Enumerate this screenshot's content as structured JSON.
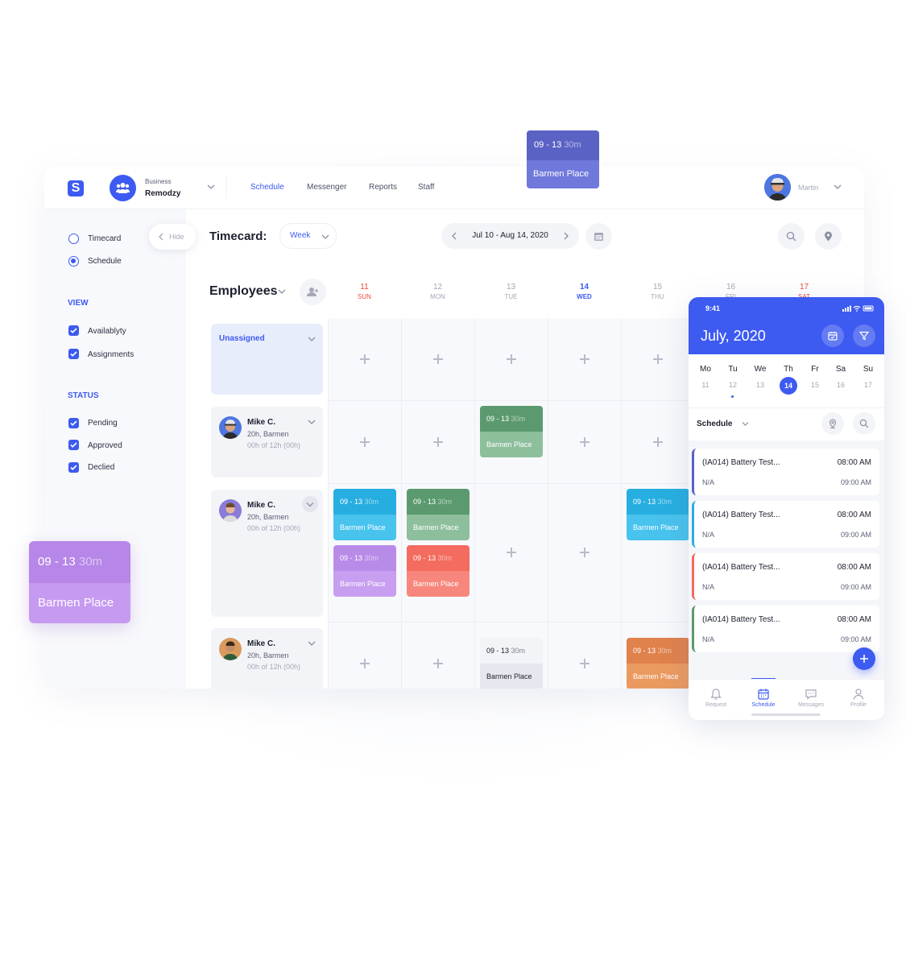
{
  "header": {
    "business_small": "Business",
    "business_name": "Remodzy",
    "nav": [
      "Schedule",
      "Messenger",
      "Reports",
      "Staff"
    ],
    "user_name": "Martin"
  },
  "sidebar": {
    "mode_options": [
      {
        "label": "Timecard",
        "selected": false
      },
      {
        "label": "Schedule",
        "selected": true
      }
    ],
    "view_heading": "VIEW",
    "view_items": [
      "Availablyty",
      "Assignments"
    ],
    "status_heading": "STATUS",
    "status_items": [
      "Pending",
      "Approved",
      "Declied"
    ],
    "hide_label": "Hide"
  },
  "toolbar": {
    "title": "Timecard:",
    "period": "Week",
    "date_range": "Jul 10 - Aug 14, 2020"
  },
  "grid": {
    "employees_title": "Employees",
    "days": [
      {
        "num": "11",
        "name": "SUN",
        "state": "weekend"
      },
      {
        "num": "12",
        "name": "MON",
        "state": "normal"
      },
      {
        "num": "13",
        "name": "TUE",
        "state": "normal"
      },
      {
        "num": "14",
        "name": "WED",
        "state": "today"
      },
      {
        "num": "15",
        "name": "THU",
        "state": "normal"
      },
      {
        "num": "16",
        "name": "FRI",
        "state": "normal"
      },
      {
        "num": "17",
        "name": "SAT",
        "state": "weekend"
      }
    ],
    "unassigned_label": "Unassigned",
    "employees": [
      {
        "name": "Mike C.",
        "role": "20h, Barmen",
        "hours": "00h of 12h (00h)"
      },
      {
        "name": "Mike C.",
        "role": "20h, Barmen",
        "hours": "00h of 12h (00h)"
      },
      {
        "name": "Mike C.",
        "role": "20h, Barmen",
        "hours": "00h of 12h (00h)"
      }
    ],
    "shift_time": "09 - 13",
    "shift_duration": "30m",
    "shift_place": "Barmen Place"
  },
  "colors": {
    "accent": "#3d5af1",
    "green": "#5b9a6e",
    "blue": "#27aee0",
    "purple": "#b98be8",
    "red": "#f46b5f",
    "orange": "#e0824c",
    "weekend": "#f04a3a"
  },
  "phone": {
    "time": "9:41",
    "month": "July, 2020",
    "weekdays": [
      "Mo",
      "Tu",
      "We",
      "Th",
      "Fr",
      "Sa",
      "Su"
    ],
    "dates": [
      "11",
      "12",
      "13",
      "14",
      "15",
      "16",
      "17"
    ],
    "selected_date": "14",
    "schedule_label": "Schedule",
    "tasks": [
      {
        "name": "(IA014) Battery Test...",
        "sub": "N/A",
        "start": "08:00 AM",
        "end": "09:00 AM",
        "color": "#5a62c4"
      },
      {
        "name": "(IA014) Battery Test...",
        "sub": "N/A",
        "start": "08:00 AM",
        "end": "09:00 AM",
        "color": "#27aee0"
      },
      {
        "name": "(IA014) Battery Test...",
        "sub": "N/A",
        "start": "08:00 AM",
        "end": "09:00 AM",
        "color": "#f46b5f"
      },
      {
        "name": "(IA014) Battery Test...",
        "sub": "N/A",
        "start": "08:00 AM",
        "end": "09:00 AM",
        "color": "#5b9a6e"
      }
    ],
    "tabs": [
      "Request",
      "Schedule",
      "Messages",
      "Profile"
    ],
    "active_tab": "Schedule"
  },
  "icons": [
    "logo-icon",
    "team-icon",
    "chevron-down-icon",
    "chevron-left-icon",
    "chevron-right-icon",
    "calendar-icon",
    "search-icon",
    "location-pin-icon",
    "add-user-icon",
    "plus-icon",
    "filter-icon",
    "bell-icon",
    "chat-icon",
    "profile-icon"
  ]
}
